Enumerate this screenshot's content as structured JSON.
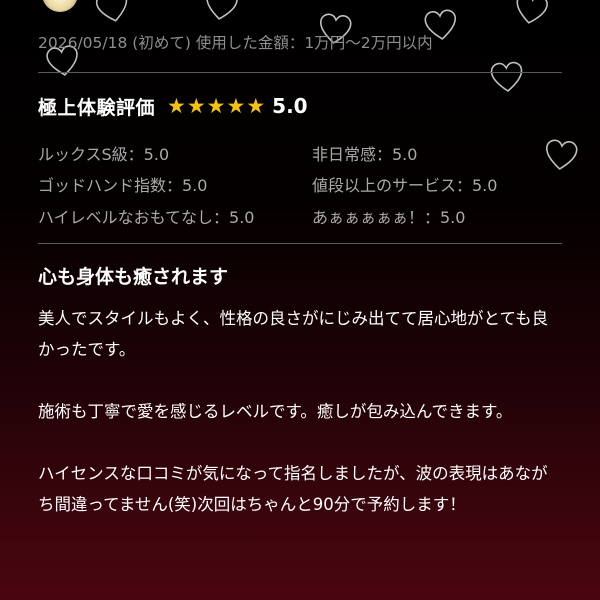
{
  "review": {
    "date": "2026/05/18",
    "visit_type": "(初めて)",
    "amount_label": "使用した金額：",
    "amount_value": "1万円〜2万円以内",
    "overall_label": "極上体験評価",
    "overall_score": "5.0",
    "star_count": 5,
    "sub_ratings": [
      {
        "text": "ルックスS級：5.0"
      },
      {
        "text": "非日常感：5.0"
      },
      {
        "text": "ゴッドハンド指数：5.0"
      },
      {
        "text": "値段以上のサービス：5.0"
      },
      {
        "text": "ハイレベルなおもてなし：5.0"
      },
      {
        "text": "あぁぁぁぁぁ！：5.0"
      }
    ],
    "title": "心も身体も癒されます",
    "paragraphs": [
      "美人でスタイルもよく、性格の良さがにじみ出てて居心地がとても良かったです。",
      "施術も丁寧で愛を感じるレベルです。癒しが包み込んできます。",
      "ハイセンスな口コミが気になって指名しましたが、波の表現はあながち間違ってません(笑)次回はちゃんと90分で予約します！"
    ]
  },
  "colors": {
    "star": "#f2c20f",
    "meta_text": "#8e8e8e",
    "sub_rating_text": "#a9a9a9",
    "divider": "#5a5a5a"
  },
  "icons": {
    "decoration": "heart-outline-icon",
    "rating": "star-icon"
  }
}
